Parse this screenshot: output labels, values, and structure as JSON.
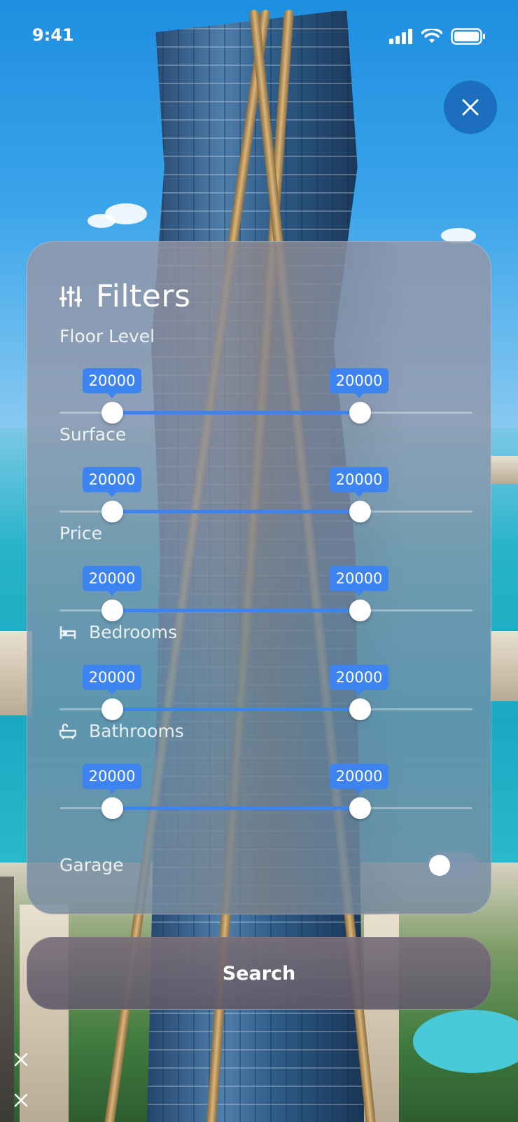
{
  "status_bar": {
    "time": "9:41"
  },
  "filters": {
    "title": "Filters",
    "sections": [
      {
        "label": "Floor Level",
        "min_label": "20000",
        "max_label": "20000"
      },
      {
        "label": "Surface",
        "min_label": "20000",
        "max_label": "20000"
      },
      {
        "label": "Price",
        "min_label": "20000",
        "max_label": "20000"
      },
      {
        "label": "Bedrooms",
        "min_label": "20000",
        "max_label": "20000",
        "icon": "bed-icon"
      },
      {
        "label": "Bathrooms",
        "min_label": "20000",
        "max_label": "20000",
        "icon": "bathtub-icon"
      }
    ],
    "garage": {
      "label": "Garage",
      "on": false
    }
  },
  "search_button": {
    "label": "Search"
  },
  "colors": {
    "accent": "#3e84f0",
    "close_button": "#1c6fbf"
  }
}
